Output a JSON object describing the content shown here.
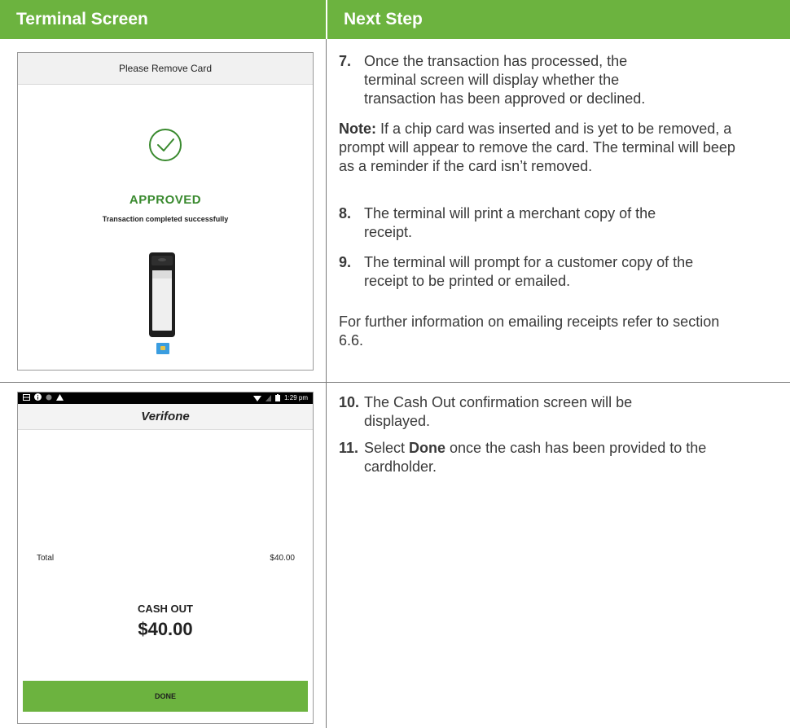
{
  "header": {
    "left": "Terminal Screen",
    "right": "Next Step"
  },
  "screen1": {
    "title": "Please Remove Card",
    "status": "APPROVED",
    "message": "Transaction completed successfully",
    "icons": [
      "check-circle-icon",
      "terminal-device-icon",
      "chip-card-icon"
    ]
  },
  "screen2": {
    "status_bar": {
      "left_icons": [
        "battery-icon",
        "info-icon",
        "circle-icon",
        "warning-icon"
      ],
      "right_icons": [
        "wifi-icon",
        "signal-icon",
        "battery-icon"
      ],
      "time": "1:29 pm"
    },
    "brand": "Verifone",
    "total_label": "Total",
    "total_value": "$40.00",
    "cash_label": "CASH OUT",
    "cash_amount": "$40.00",
    "done_label": "DONE"
  },
  "steps": {
    "s7": {
      "num": "7.",
      "text": "Once the transaction has processed, the terminal screen will display whether the transaction has been approved or declined."
    },
    "note": {
      "label": "Note:",
      "text": " If a chip card was inserted and is yet to be removed, a prompt will appear to remove the card. The terminal will beep as a reminder if the card isn’t removed."
    },
    "s8": {
      "num": "8.",
      "text": "The terminal will print a merchant copy of the receipt."
    },
    "s9": {
      "num": "9.",
      "text": "The terminal will prompt for a customer copy of the receipt to be printed or emailed."
    },
    "further": "For further information on emailing receipts refer to section 6.6.",
    "s10": {
      "num": "10.",
      "text": "The Cash Out confirmation screen will be displayed."
    },
    "s11": {
      "num": "11.",
      "pre": "Select ",
      "bold": "Done",
      "post": " once the cash has been provided to the cardholder."
    }
  },
  "colors": {
    "header_green": "#6cb33f",
    "approved_green": "#3a8a2f",
    "divider": "#7a7a7a"
  }
}
